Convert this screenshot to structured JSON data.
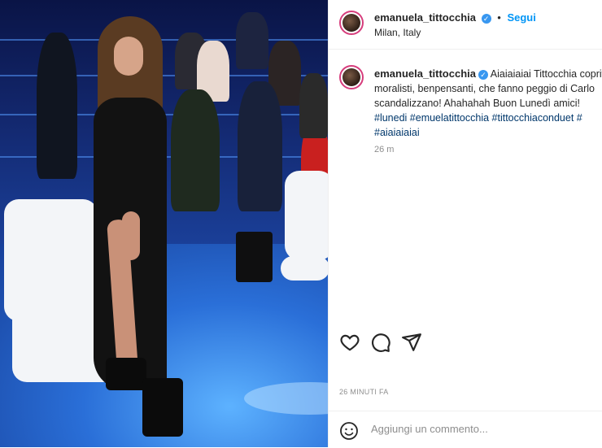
{
  "post": {
    "username": "emanuela_tittocchia",
    "follow_label": "Segui",
    "location": "Milan, Italy",
    "caption_lines": [
      "Aiaiaiaiai Tittocchia copriti",
      "moralisti, benpensanti, che fanno peggio di Carlo",
      "scandalizzano! Ahahahah Buon Lunedì amici!"
    ],
    "hashtags_line1": "#lunedi #emuelatittocchia #tittocchiaconduet #",
    "hashtags_line2": "#aiaiaiaiai",
    "caption_time": "26 m",
    "posted_ago": "26 MINUTI FA"
  },
  "comment": {
    "placeholder": "Aggiungi un commento..."
  },
  "icons": {
    "verified": "verified-badge-icon",
    "like": "heart-icon",
    "comment": "comment-bubble-icon",
    "share": "paper-plane-icon",
    "emoji": "smiley-icon"
  },
  "colors": {
    "link": "#0095f6",
    "hashtag": "#00376b",
    "muted": "#8e8e8e",
    "story_ring": "#d63d7c"
  }
}
